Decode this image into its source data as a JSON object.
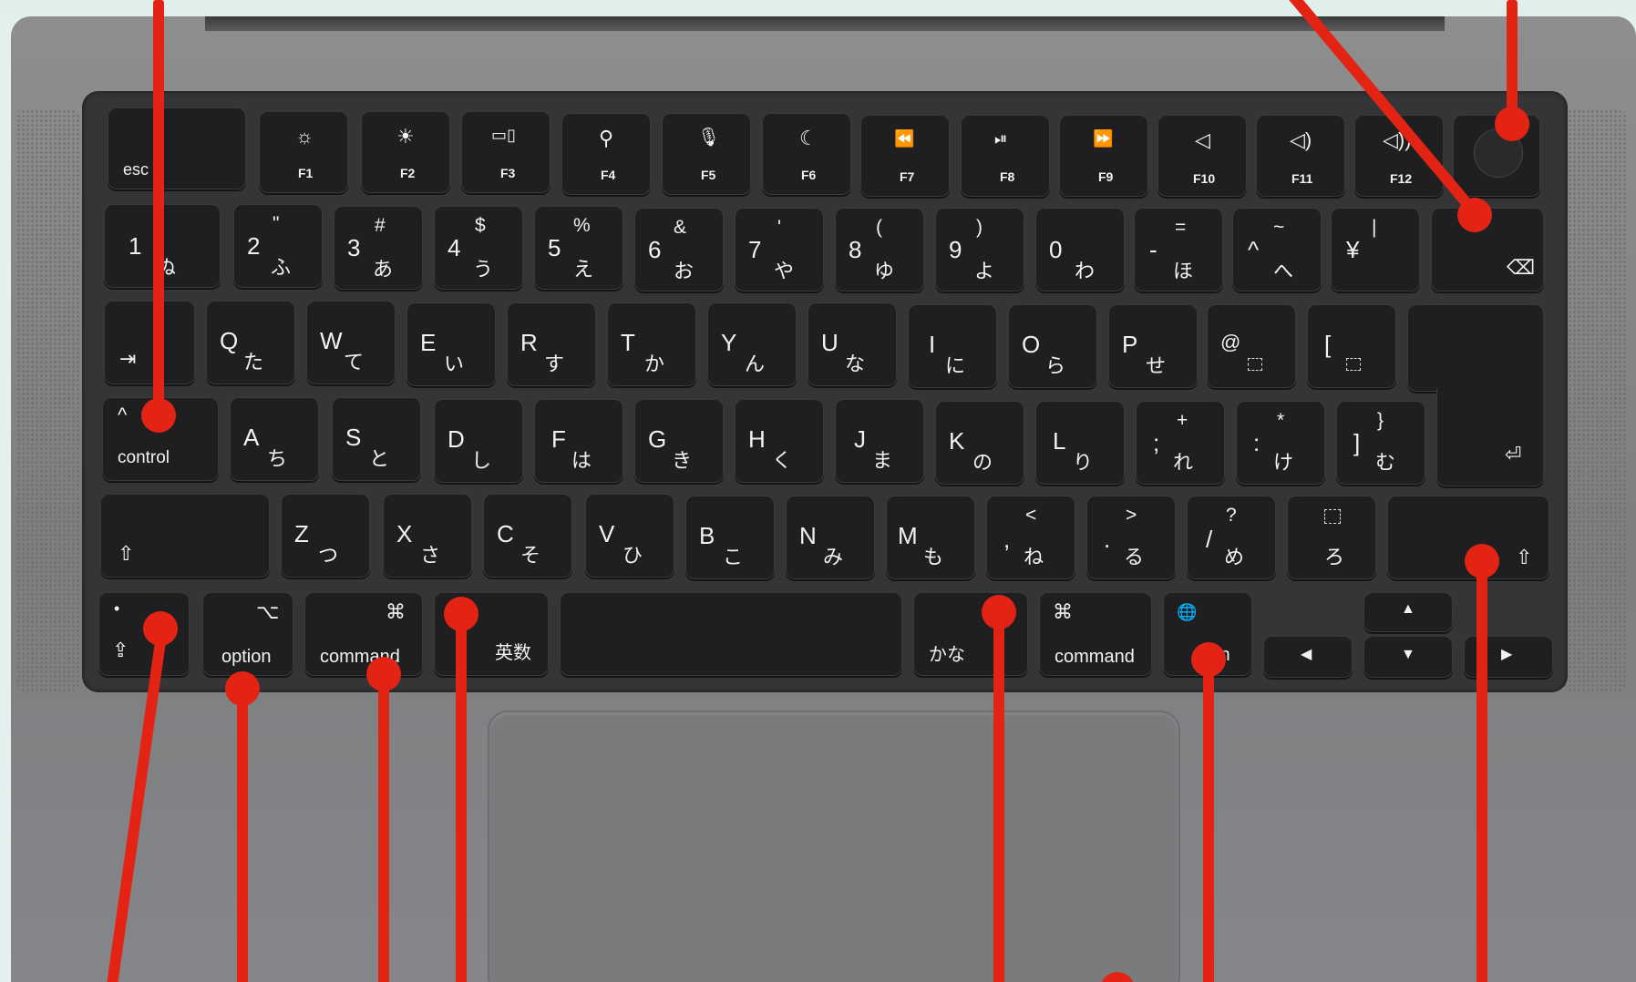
{
  "function_row": [
    {
      "main": "esc"
    },
    {
      "icon": "☼",
      "label": "F1"
    },
    {
      "icon": "☀",
      "label": "F2"
    },
    {
      "icon": "▭▯",
      "label": "F3"
    },
    {
      "icon": "⚲",
      "label": "F4"
    },
    {
      "icon": "🎙",
      "label": "F5"
    },
    {
      "icon": "☾",
      "label": "F6"
    },
    {
      "icon": "⏪",
      "label": "F7"
    },
    {
      "icon": "⏯",
      "label": "F8"
    },
    {
      "icon": "⏩",
      "label": "F9"
    },
    {
      "icon": "◁",
      "label": "F10"
    },
    {
      "icon": "◁)",
      "label": "F11"
    },
    {
      "icon": "◁))",
      "label": "F12"
    }
  ],
  "number_row": [
    {
      "main": "1",
      "kana": "ぬ",
      "sub": ""
    },
    {
      "main": "2",
      "kana": "ふ",
      "sub": "\""
    },
    {
      "main": "3",
      "kana": "あ",
      "sub": "#"
    },
    {
      "main": "4",
      "kana": "う",
      "sub": "$"
    },
    {
      "main": "5",
      "kana": "え",
      "sub": "%"
    },
    {
      "main": "6",
      "kana": "お",
      "sub": "&"
    },
    {
      "main": "7",
      "kana": "や",
      "sub": "'"
    },
    {
      "main": "8",
      "kana": "ゆ",
      "sub": "("
    },
    {
      "main": "9",
      "kana": "よ",
      "sub": ")"
    },
    {
      "main": "0",
      "kana": "わ",
      "sub": ""
    },
    {
      "main": "-",
      "kana": "ほ",
      "sub": "="
    },
    {
      "main": "^",
      "kana": "へ",
      "sub": "~"
    },
    {
      "main": "¥",
      "kana": "",
      "sub": "|"
    }
  ],
  "qwerty_row": [
    {
      "main": "Q",
      "kana": "た"
    },
    {
      "main": "W",
      "kana": "て"
    },
    {
      "main": "E",
      "kana": "い"
    },
    {
      "main": "R",
      "kana": "す"
    },
    {
      "main": "T",
      "kana": "か"
    },
    {
      "main": "Y",
      "kana": "ん"
    },
    {
      "main": "U",
      "kana": "な"
    },
    {
      "main": "I",
      "kana": "に"
    },
    {
      "main": "O",
      "kana": "ら"
    },
    {
      "main": "P",
      "kana": "せ"
    },
    {
      "main": "@",
      "kana": ""
    },
    {
      "main": "[",
      "kana": ""
    }
  ],
  "home_row": [
    {
      "main": "A",
      "kana": "ち"
    },
    {
      "main": "S",
      "kana": "と"
    },
    {
      "main": "D",
      "kana": "し"
    },
    {
      "main": "F",
      "kana": "は"
    },
    {
      "main": "G",
      "kana": "き"
    },
    {
      "main": "H",
      "kana": "く"
    },
    {
      "main": "J",
      "kana": "ま"
    },
    {
      "main": "K",
      "kana": "の"
    },
    {
      "main": "L",
      "kana": "り"
    },
    {
      "main": ";",
      "kana": "れ"
    },
    {
      "main": ":",
      "kana": "け"
    },
    {
      "main": "]",
      "kana": "む"
    }
  ],
  "home_row_subs": [
    "+",
    "*",
    "}"
  ],
  "shift_row": [
    {
      "main": "Z",
      "kana": "つ"
    },
    {
      "main": "X",
      "kana": "さ"
    },
    {
      "main": "C",
      "kana": "そ"
    },
    {
      "main": "V",
      "kana": "ひ"
    },
    {
      "main": "B",
      "kana": "こ"
    },
    {
      "main": "N",
      "kana": "み"
    },
    {
      "main": "M",
      "kana": "も"
    },
    {
      "main": ",",
      "kana": "ね"
    },
    {
      "main": ".",
      "kana": "る"
    },
    {
      "main": "/",
      "kana": "め"
    },
    {
      "main": "",
      "kana": "ろ"
    }
  ],
  "shift_row_subs": [
    "<",
    ">",
    "?"
  ],
  "modifiers": {
    "tab": "⇥",
    "control_icon": "^",
    "control": "control",
    "shift_icon": "⇧",
    "return_icon": "⏎",
    "delete_icon": "⌫",
    "globe_bottom": "⇪",
    "option_icon": "⌥",
    "option": "option",
    "command_icon": "⌘",
    "command": "command",
    "eisu": "英数",
    "kana_key": "かな",
    "fn_icon": "🌐",
    "fn": "fn",
    "arrow_up": "▲",
    "arrow_down": "▼",
    "arrow_left": "◀",
    "arrow_right": "▶"
  },
  "annotation_color": "#e32414"
}
